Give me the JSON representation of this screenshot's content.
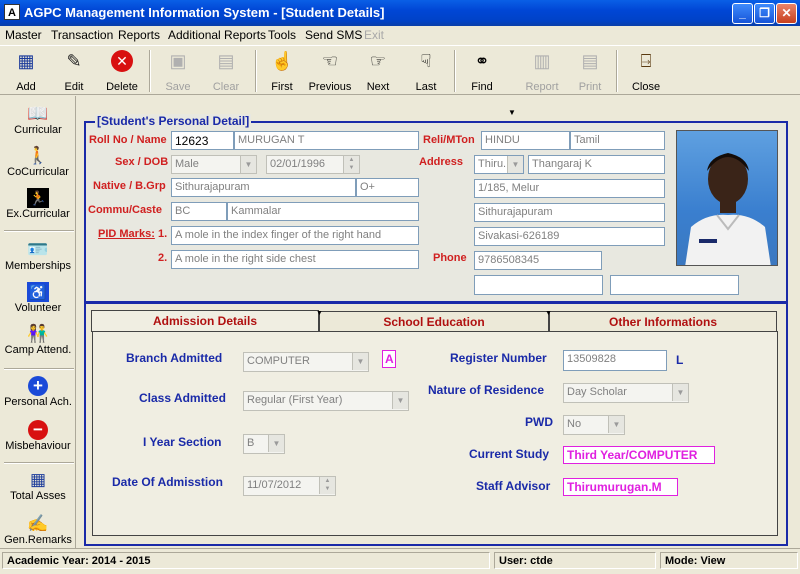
{
  "window": {
    "title": "AGPC Management Information System - [Student Details]"
  },
  "menu": [
    "Master",
    "Transaction",
    "Reports",
    "Additional Reports",
    "Tools",
    "Send SMS",
    "Exit"
  ],
  "toolbar": {
    "add": "Add",
    "edit": "Edit",
    "delete": "Delete",
    "save": "Save",
    "clear": "Clear",
    "first": "First",
    "previous": "Previous",
    "next": "Next",
    "last": "Last",
    "find": "Find",
    "report": "Report",
    "print": "Print",
    "close": "Close"
  },
  "sidebar": [
    "Curricular",
    "CoCurricular",
    "Ex.Curricular",
    "Memberships",
    "Volunteer",
    "Camp Attend.",
    "Personal Ach.",
    "Misbehaviour",
    "Total Asses",
    "Gen.Remarks"
  ],
  "personal": {
    "legend": "[Student's Personal Detail]",
    "labels": {
      "roll": "Roll No / Name",
      "sex": "Sex / DOB",
      "native": "Native / B.Grp",
      "commu": "Commu/Caste",
      "pid": "PID Marks:",
      "pid1": "1.",
      "pid2": "2.",
      "reli": "Reli/MTon",
      "address": "Address",
      "phone": "Phone"
    },
    "roll_no": "12623",
    "name": "MURUGAN T",
    "sex": "Male",
    "dob": "02/01/1996",
    "native": "Sithurajapuram",
    "blood_group": "O+",
    "community": "BC",
    "caste": "Kammalar",
    "pid_mark_1": "A mole in the index finger of the right hand",
    "pid_mark_2": "A mole in the right side chest",
    "religion": "HINDU",
    "mother_tongue": "Tamil",
    "address_prefix": "Thiru.",
    "address_1": "Thangaraj K",
    "address_2": "1/185, Melur",
    "address_3": "Sithurajapuram",
    "address_4": "Sivakasi-626189",
    "phone": "9786508345"
  },
  "tabs": [
    "Admission Details",
    "School Education",
    "Other Informations"
  ],
  "admission": {
    "labels": {
      "branch": "Branch Admitted",
      "class": "Class Admitted",
      "section": "I Year Section",
      "date": "Date Of Admisstion",
      "register": "Register Number",
      "residence": "Nature of Residence",
      "pwd": "PWD",
      "current_study": "Current Study",
      "staff_advisor": "Staff Advisor"
    },
    "branch": "COMPUTER",
    "branch_code": "A",
    "class": "Regular (First Year)",
    "section": "B",
    "date": "11/07/2012",
    "register_number": "13509828",
    "register_suffix": "L",
    "residence": "Day Scholar",
    "pwd": "No",
    "current_study": "Third Year/COMPUTER",
    "staff_advisor": "Thirumurugan.M"
  },
  "status": {
    "academic_year": "Academic Year: 2014 - 2015",
    "user": "User: ctde",
    "mode": "Mode: View"
  }
}
